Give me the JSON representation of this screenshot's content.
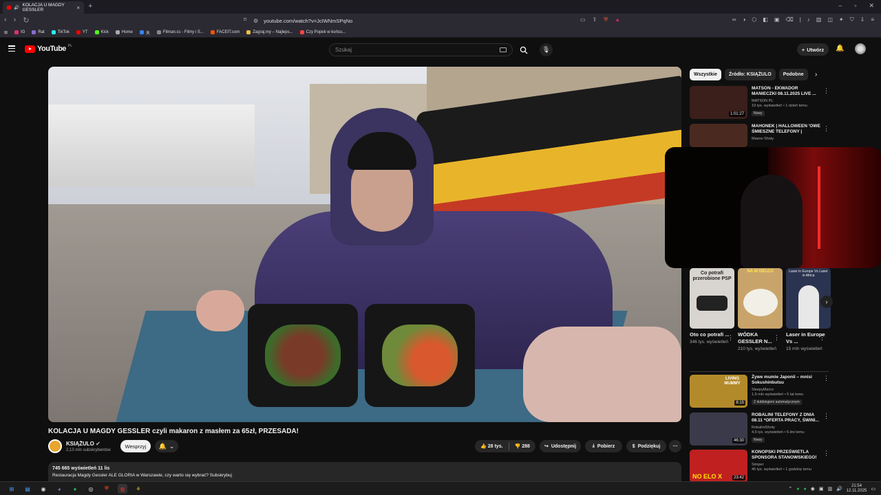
{
  "browser": {
    "tab_title": "KOLACJA U MAGDY GESSLER",
    "url": "youtube.com/watch?v=JcIWNmSPqNo",
    "bookmarks": [
      {
        "label": "IG",
        "color": "#e1306c"
      },
      {
        "label": "Rat",
        "color": "#8a6bd1"
      },
      {
        "label": "TikTok",
        "color": "#25f4ee"
      },
      {
        "label": "YT",
        "color": "#ff0000"
      },
      {
        "label": "Kick",
        "color": "#53fc18"
      },
      {
        "label": "Home",
        "color": "#aaaaaa"
      },
      {
        "label": "天",
        "color": "#3b82f6"
      },
      {
        "label": "Filman.cc - Filmy i S...",
        "color": "#888888"
      },
      {
        "label": "FACEIT.com",
        "color": "#ff5500"
      },
      {
        "label": "Zagraj.my – Najleps...",
        "color": "#f0c040"
      },
      {
        "label": "Czy Popek w końcu...",
        "color": "#ff4444"
      }
    ]
  },
  "youtube": {
    "logo_text": "YouTube",
    "region": "PL",
    "search_placeholder": "Szukaj",
    "create_label": "Utwórz"
  },
  "video": {
    "title": "KOLACJA U MAGDY GESSLER czyli makaron z masłem za 65zł, PRZESADA!",
    "channel_name": "KSIĄŻULO",
    "subscribers": "2,13 mln subskrybentów",
    "support_label": "Wesprzyj",
    "likes": "28 tys.",
    "dislikes": "288",
    "share_label": "Udostępnij",
    "download_label": "Pobierz",
    "thanks_label": "Podziękuj",
    "views_line": "745 665 wyświetleń  11 lis",
    "description": "Restauracja Magdy Gessler ALE GLORIA w Warszawie, czy warto się wybrać? Subskrybuj"
  },
  "sidebar": {
    "chips": [
      "Wszystkie",
      "Źródło: KSIĄŻULO",
      "Podobne"
    ],
    "recommended_top": [
      {
        "title": "MATSON - EKWADOR MANIECZKI 08.11.2025 LIVE ...",
        "channel": "MATSON PL",
        "meta": "19 tys. wyświetleń • 1 dzień temu",
        "badge": "Nowy",
        "duration": "1:01:27",
        "color": "#3a1f1a"
      },
      {
        "title": "MAHONEK | HALLOWEEN 'OWE ŚMIESZNE TELEFONY |",
        "channel": "Masne Shoty",
        "meta": "",
        "badge": "",
        "duration": "",
        "color": "#4a2a20"
      }
    ],
    "shorts": [
      {
        "title": "Oto co potrafi ...",
        "views": "346 tys. wyświetleń",
        "color": "#d8d4cf",
        "overlay": "Co potrafi przerobione PSP"
      },
      {
        "title": "WÓDKA GESSLER N...",
        "views": "210 tys. wyświetleń",
        "color": "#c9a46a",
        "overlay": "NA W DELCU"
      },
      {
        "title": "Laser in Europe Vs ...",
        "views": "15 mln wyświetleń",
        "color": "#2a3450",
        "overlay": "Laser in Europe Vs Laser in Africa"
      }
    ],
    "recommended_bottom": [
      {
        "title": "Żywe mumie Japonii – mnisi Sokushinbutsu",
        "channel": "SleepyMarco",
        "meta": "1,6 mln wyświetleń • 5 lat temu",
        "badge": "Z dubbingiem automatycznym",
        "duration": "8:15",
        "color": "#b38a2a",
        "overlay": "LIVING MUMMY"
      },
      {
        "title": "ROBALINI TELEFONY Z DNIA 08.11 *OFERTA PRACY, ŚWINI...",
        "channel": "RobaliniShoty",
        "meta": "4,6 tys. wyświetleń • 5 dni temu",
        "badge": "Nowy",
        "duration": "46:30",
        "color": "#3a3a4a",
        "overlay": ""
      },
      {
        "title": "KONOPSKI PRZEŚWIETLA SPONSORA STANOWSKIEGO!",
        "channel": "Simper",
        "meta": "45 tys. wyświetleń • 1 godzinę temu",
        "badge": "",
        "duration": "23:42",
        "color": "#c02020",
        "overlay": "NO ELO X"
      }
    ]
  },
  "taskbar": {
    "time": "21:54",
    "date": "12.11.2025"
  }
}
